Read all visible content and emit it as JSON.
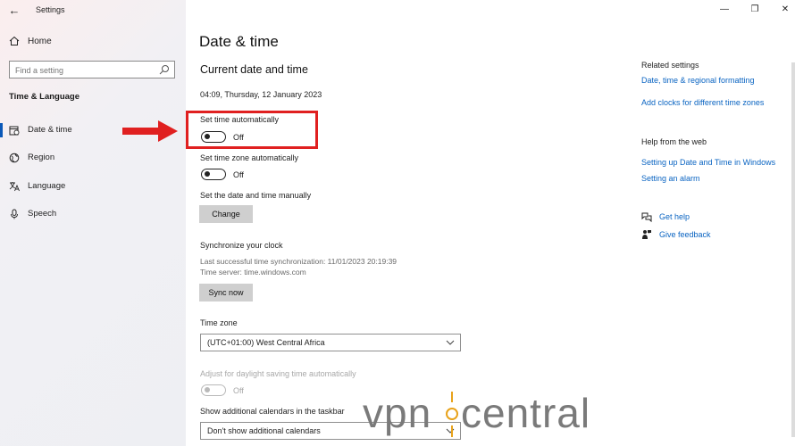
{
  "window": {
    "title": "Settings",
    "controls": {
      "minimize": "—",
      "restore": "❐",
      "close": "✕"
    }
  },
  "sidebar": {
    "home_label": "Home",
    "search_placeholder": "Find a setting",
    "section_title": "Time & Language",
    "items": [
      {
        "label": "Date & time",
        "icon": "calendar-clock-icon",
        "active": true
      },
      {
        "label": "Region",
        "icon": "globe-icon",
        "active": false
      },
      {
        "label": "Language",
        "icon": "language-icon",
        "active": false
      },
      {
        "label": "Speech",
        "icon": "microphone-icon",
        "active": false
      }
    ]
  },
  "main": {
    "page_title": "Date & time",
    "section_title": "Current date and time",
    "current_datetime": "04:09, Thursday, 12 January 2023",
    "set_time_auto": {
      "label": "Set time automatically",
      "state": "Off"
    },
    "set_timezone_auto": {
      "label": "Set time zone automatically",
      "state": "Off"
    },
    "manual": {
      "label": "Set the date and time manually",
      "button": "Change"
    },
    "sync": {
      "title": "Synchronize your clock",
      "last_sync": "Last successful time synchronization: 11/01/2023 20:19:39",
      "server": "Time server: time.windows.com",
      "button": "Sync now"
    },
    "timezone": {
      "label": "Time zone",
      "value": "(UTC+01:00) West Central Africa"
    },
    "daylight": {
      "label": "Adjust for daylight saving time automatically",
      "state": "Off"
    },
    "calendars": {
      "label": "Show additional calendars in the taskbar",
      "value": "Don't show additional calendars"
    }
  },
  "right_panel": {
    "related_title": "Related settings",
    "related_links": [
      "Date, time & regional formatting",
      "Add clocks for different time zones"
    ],
    "help_title": "Help from the web",
    "help_links": [
      "Setting up Date and Time in Windows",
      "Setting an alarm"
    ],
    "get_help": "Get help",
    "give_feedback": "Give feedback"
  },
  "annotation": {
    "highlight_color": "#e02020"
  },
  "watermark": {
    "text_left": "vpn",
    "text_right": "central",
    "accent": "#e8a21a"
  },
  "colors": {
    "link": "#0a64c2",
    "accent": "#0a58b8"
  }
}
